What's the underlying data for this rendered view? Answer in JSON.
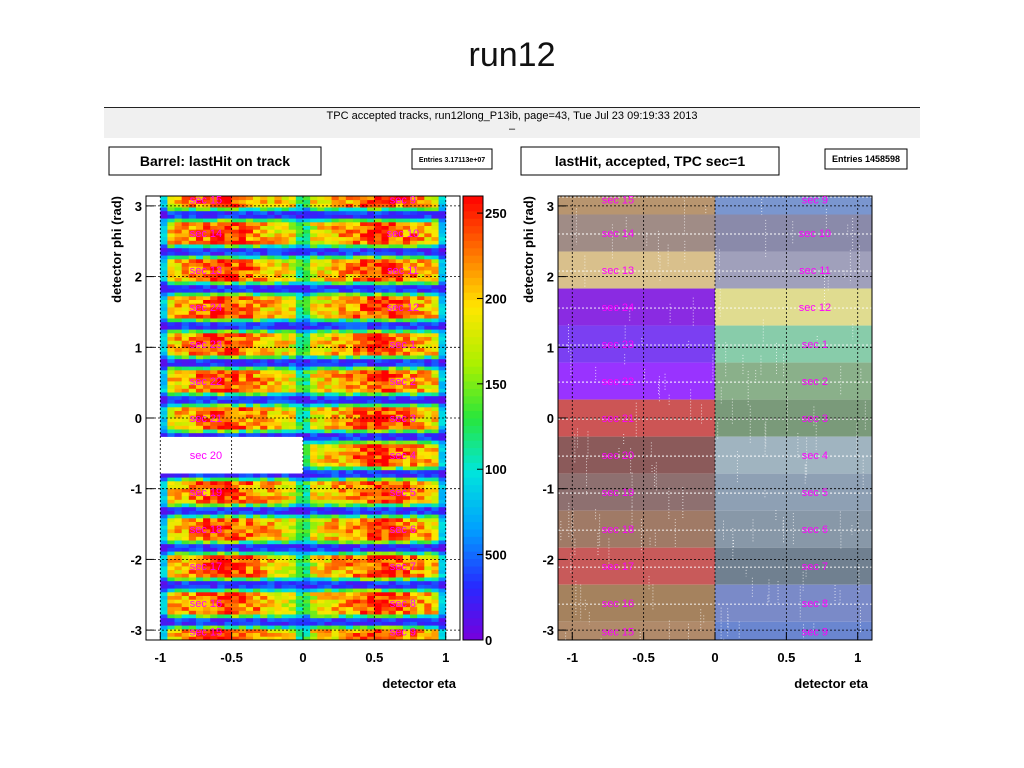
{
  "slide": {
    "title": "run12"
  },
  "canvas_header": {
    "text": "TPC accepted tracks, run12long_P13ib, page=43,  Tue Jul 23 09:19:33 2013",
    "dash": "–"
  },
  "colors": {
    "sector_label": "#ff00ff",
    "frame": "#000000"
  },
  "chart_data": [
    {
      "type": "heatmap",
      "title": "Barrel: lastHit on track",
      "stats": "Entries 3.17113e+07",
      "xlabel": "detector eta",
      "ylabel": "detector phi (rad)",
      "xlim": [
        -1.1,
        1.1
      ],
      "ylim": [
        -3.14,
        3.14
      ],
      "xticks": [
        -1,
        -0.5,
        0,
        0.5,
        1
      ],
      "xtick_labels": [
        "-1",
        "-0.5",
        "0",
        "0.5",
        "1"
      ],
      "yticks": [
        -3,
        -2,
        -1,
        0,
        1,
        2,
        3
      ],
      "ytick_labels": [
        "-3",
        "-2",
        "-1",
        "0",
        "1",
        "2",
        "3"
      ],
      "zlim": [
        0,
        260
      ],
      "zticks": [
        0,
        50,
        100,
        150,
        200,
        250
      ],
      "ztick_labels": [
        "0",
        "500",
        "100",
        "150",
        "200",
        "250"
      ],
      "grid": true,
      "empty_region": {
        "sector": "sec 20",
        "eta": [
          -1.1,
          0
        ],
        "phi_center": -0.524
      },
      "sector_labels": [
        {
          "text": "sec 15",
          "eta": -0.68,
          "phi": 3.14
        },
        {
          "text": "sec 14",
          "eta": -0.68,
          "phi": 2.618
        },
        {
          "text": "sec 13",
          "eta": -0.68,
          "phi": 2.094
        },
        {
          "text": "sec 24",
          "eta": -0.68,
          "phi": 1.571
        },
        {
          "text": "sec 23",
          "eta": -0.68,
          "phi": 1.047
        },
        {
          "text": "sec 22",
          "eta": -0.68,
          "phi": 0.524
        },
        {
          "text": "sec 21",
          "eta": -0.68,
          "phi": 0.0
        },
        {
          "text": "sec 20",
          "eta": -0.68,
          "phi": -0.524
        },
        {
          "text": "sec 19",
          "eta": -0.68,
          "phi": -1.047
        },
        {
          "text": "sec 18",
          "eta": -0.68,
          "phi": -1.571
        },
        {
          "text": "sec 17",
          "eta": -0.68,
          "phi": -2.094
        },
        {
          "text": "sec 16",
          "eta": -0.68,
          "phi": -2.618
        },
        {
          "text": "sec 15",
          "eta": -0.68,
          "phi": -3.14
        },
        {
          "text": "sec 9",
          "eta": 0.7,
          "phi": 3.14
        },
        {
          "text": "sec 10",
          "eta": 0.7,
          "phi": 2.618
        },
        {
          "text": "sec 11",
          "eta": 0.7,
          "phi": 2.094
        },
        {
          "text": "sec 12",
          "eta": 0.7,
          "phi": 1.571
        },
        {
          "text": "sec 1",
          "eta": 0.7,
          "phi": 1.047
        },
        {
          "text": "sec 2",
          "eta": 0.7,
          "phi": 0.524
        },
        {
          "text": "sec 3",
          "eta": 0.7,
          "phi": 0.0
        },
        {
          "text": "sec 4",
          "eta": 0.7,
          "phi": -0.524
        },
        {
          "text": "sec 5",
          "eta": 0.7,
          "phi": -1.047
        },
        {
          "text": "sec 6",
          "eta": 0.7,
          "phi": -1.571
        },
        {
          "text": "sec 7",
          "eta": 0.7,
          "phi": -2.094
        },
        {
          "text": "sec 8",
          "eta": 0.7,
          "phi": -2.618
        },
        {
          "text": "sec 9",
          "eta": 0.7,
          "phi": -3.14
        }
      ]
    },
    {
      "type": "heatmap",
      "title": "lastHit, accepted, TPC sec=1",
      "stats": "Entries 1458598",
      "xlabel": "detector eta",
      "ylabel": "detector phi (rad)",
      "xlim": [
        -1.1,
        1.1
      ],
      "ylim": [
        -3.14,
        3.14
      ],
      "xticks": [
        -1,
        -0.5,
        0,
        0.5,
        1
      ],
      "xtick_labels": [
        "-1",
        "-0.5",
        "0",
        "0.5",
        "1"
      ],
      "yticks": [
        -3,
        -2,
        -1,
        0,
        1,
        2,
        3
      ],
      "ytick_labels": [
        "-3",
        "-2",
        "-1",
        "0",
        "1",
        "2",
        "3"
      ],
      "grid": true,
      "sector_colors_east": [
        "#b8956f",
        "#a08c86",
        "#d9c08c",
        "#8a2be2",
        "#7b3ff2",
        "#9933ff",
        "#cc5555",
        "#8b5a5a",
        "#8e7070",
        "#a07a66",
        "#c85a5a",
        "#a5825e",
        "#b08a6a"
      ],
      "sector_colors_west": [
        "#7a96cf",
        "#8a8aaa",
        "#a0a0bb",
        "#e0dc90",
        "#88ccaa",
        "#8ab08a",
        "#7a9a7a",
        "#a0b4c0",
        "#8ea0b4",
        "#8898a8",
        "#708090",
        "#7a8ac8",
        "#6a86d0"
      ],
      "sector_labels": [
        {
          "text": "sec 15",
          "eta": -0.68,
          "phi": 3.14
        },
        {
          "text": "sec 14",
          "eta": -0.68,
          "phi": 2.618
        },
        {
          "text": "sec 13",
          "eta": -0.68,
          "phi": 2.094
        },
        {
          "text": "sec 24",
          "eta": -0.68,
          "phi": 1.571
        },
        {
          "text": "sec 23",
          "eta": -0.68,
          "phi": 1.047
        },
        {
          "text": "sec 22",
          "eta": -0.68,
          "phi": 0.524
        },
        {
          "text": "sec 21",
          "eta": -0.68,
          "phi": 0.0
        },
        {
          "text": "sec 20",
          "eta": -0.68,
          "phi": -0.524
        },
        {
          "text": "sec 19",
          "eta": -0.68,
          "phi": -1.047
        },
        {
          "text": "sec 18",
          "eta": -0.68,
          "phi": -1.571
        },
        {
          "text": "sec 17",
          "eta": -0.68,
          "phi": -2.094
        },
        {
          "text": "sec 16",
          "eta": -0.68,
          "phi": -2.618
        },
        {
          "text": "sec 15",
          "eta": -0.68,
          "phi": -3.14
        },
        {
          "text": "sec 9",
          "eta": 0.7,
          "phi": 3.14
        },
        {
          "text": "sec 10",
          "eta": 0.7,
          "phi": 2.618
        },
        {
          "text": "sec 11",
          "eta": 0.7,
          "phi": 2.094
        },
        {
          "text": "sec 12",
          "eta": 0.7,
          "phi": 1.571
        },
        {
          "text": "sec 1",
          "eta": 0.7,
          "phi": 1.047
        },
        {
          "text": "sec 2",
          "eta": 0.7,
          "phi": 0.524
        },
        {
          "text": "sec 3",
          "eta": 0.7,
          "phi": 0.0
        },
        {
          "text": "sec 4",
          "eta": 0.7,
          "phi": -0.524
        },
        {
          "text": "sec 5",
          "eta": 0.7,
          "phi": -1.047
        },
        {
          "text": "sec 6",
          "eta": 0.7,
          "phi": -1.571
        },
        {
          "text": "sec 7",
          "eta": 0.7,
          "phi": -2.094
        },
        {
          "text": "sec 8",
          "eta": 0.7,
          "phi": -2.618
        },
        {
          "text": "sec 9",
          "eta": 0.7,
          "phi": -3.14
        }
      ]
    }
  ]
}
